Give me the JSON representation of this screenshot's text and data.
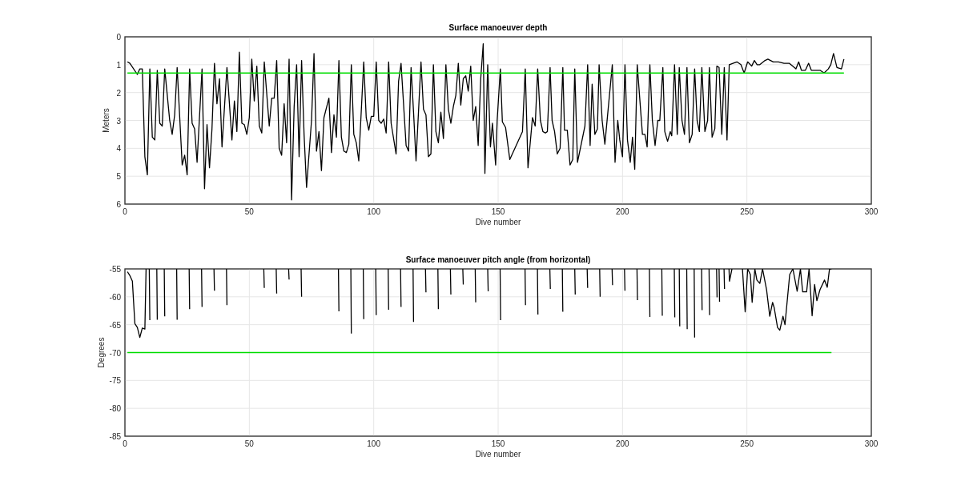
{
  "figure": {
    "plots": [
      {
        "chart_data": {
          "type": "line",
          "title": "Surface manoeuver depth",
          "xlabel": "Dive number",
          "ylabel": "Meters",
          "xlim": [
            0,
            300
          ],
          "ylim": [
            6,
            0
          ],
          "grid": true,
          "xticks": [
            0,
            50,
            100,
            150,
            200,
            250,
            300
          ],
          "yticks": [
            0,
            1,
            2,
            3,
            4,
            5,
            6
          ],
          "x": [
            1,
            2,
            5,
            6,
            7,
            8,
            9,
            10,
            11,
            12,
            13,
            14,
            15,
            16,
            18,
            19,
            20,
            21,
            23,
            24,
            25,
            26,
            27,
            28,
            29,
            31,
            32,
            33,
            34,
            35,
            36,
            37,
            38,
            39,
            41,
            43,
            44,
            45,
            46,
            47,
            48,
            49,
            50,
            51,
            52,
            53,
            54,
            55,
            56,
            58,
            59,
            60,
            61,
            62,
            63,
            64,
            65,
            66,
            67,
            68,
            69,
            70,
            71,
            72,
            73,
            75,
            76,
            77,
            78,
            79,
            80,
            82,
            83,
            84,
            85,
            86,
            87,
            88,
            89,
            90,
            91,
            92,
            93,
            94,
            96,
            97,
            98,
            99,
            100,
            101,
            102,
            103,
            104,
            105,
            106,
            107,
            109,
            110,
            111,
            113,
            114,
            115,
            116,
            117,
            119,
            120,
            121,
            122,
            123,
            124,
            125,
            126,
            127,
            128,
            129,
            130,
            131,
            132,
            133,
            134,
            135,
            136,
            137,
            138,
            139,
            140,
            141,
            142,
            143,
            144,
            144.7,
            145.8,
            146.9,
            147.7,
            149,
            149.6,
            150.9,
            151.7,
            153,
            154.7,
            159.8,
            160.9,
            162,
            163.8,
            164.9,
            165.9,
            167,
            168,
            169,
            169.8,
            170.9,
            171.7,
            172.7,
            173.8,
            174.9,
            176,
            176.7,
            177.8,
            178.9,
            180,
            180.8,
            181.9,
            184.9,
            186,
            187,
            187.8,
            188.9,
            189.9,
            190.6,
            191.8,
            192.9,
            195.9,
            197,
            198.1,
            198.9,
            200,
            201,
            202,
            203.1,
            204,
            204.9,
            205.9,
            208,
            209,
            209.9,
            211,
            212,
            213.1,
            214.2,
            215,
            216.2,
            217,
            218.1,
            219.2,
            219.8,
            220.9,
            222,
            222.8,
            223.9,
            224.9,
            225.9,
            226.9,
            228,
            229,
            230,
            230.9,
            231.9,
            233.1,
            234.2,
            234.9,
            236,
            237.1,
            237.9,
            238.8,
            239.9,
            240.9,
            242,
            242.9,
            244.4,
            246,
            247.6,
            248.9,
            250.3,
            251.9,
            253,
            254.1,
            255.2,
            257.3,
            258.4,
            260.6,
            262.7,
            264.9,
            267,
            269.7,
            270.8,
            271.9,
            273.5,
            274.8,
            275.9,
            277.8,
            279.4,
            281,
            282.7,
            283.7,
            284.8,
            286.2,
            288,
            289
          ],
          "series": [
            {
              "color": "#000000",
              "values": [
                0.9,
                0.95,
                1.35,
                1.15,
                1.15,
                4.3,
                4.95,
                1.15,
                3.6,
                3.7,
                1.2,
                3.1,
                3.2,
                1.15,
                3.0,
                3.5,
                2.8,
                1.1,
                4.6,
                4.25,
                4.95,
                1.15,
                3.1,
                3.3,
                4.5,
                1.15,
                5.45,
                3.15,
                4.7,
                3.3,
                0.95,
                2.4,
                1.5,
                3.95,
                1.1,
                3.7,
                2.3,
                3.4,
                0.55,
                3.1,
                3.15,
                3.5,
                2.9,
                0.8,
                2.3,
                1.05,
                3.2,
                3.45,
                0.9,
                3.2,
                2.2,
                2.2,
                0.85,
                4.0,
                4.25,
                2.4,
                3.8,
                0.8,
                5.85,
                2.5,
                1.0,
                4.3,
                0.85,
                3.5,
                5.4,
                3.0,
                0.6,
                4.1,
                3.4,
                4.8,
                2.9,
                2.2,
                4.15,
                2.8,
                3.6,
                0.85,
                3.6,
                4.1,
                4.15,
                3.85,
                1.0,
                3.5,
                3.8,
                4.45,
                0.9,
                2.9,
                3.35,
                2.85,
                2.85,
                0.9,
                3.0,
                3.1,
                2.95,
                3.45,
                0.9,
                3.1,
                4.2,
                1.6,
                0.95,
                3.9,
                4.1,
                1.1,
                2.7,
                4.45,
                0.9,
                2.6,
                2.8,
                4.3,
                4.2,
                1.0,
                3.4,
                3.8,
                2.7,
                3.65,
                1.0,
                2.6,
                3.1,
                2.5,
                2.1,
                0.95,
                2.45,
                1.5,
                1.4,
                1.95,
                1.05,
                3.0,
                2.5,
                3.9,
                1.5,
                0.25,
                4.9,
                1.0,
                3.95,
                3.1,
                4.6,
                3.0,
                1.15,
                3.05,
                3.25,
                4.4,
                3.4,
                1.15,
                4.7,
                2.9,
                3.2,
                1.15,
                3.0,
                3.4,
                3.45,
                3.4,
                1.1,
                3.0,
                3.4,
                4.2,
                4.0,
                1.1,
                3.35,
                3.35,
                4.6,
                4.4,
                1.15,
                4.5,
                3.2,
                1.0,
                3.9,
                1.7,
                3.5,
                3.3,
                1.0,
                3.0,
                3.85,
                1.0,
                4.5,
                3.0,
                3.7,
                4.3,
                1.0,
                3.7,
                4.5,
                3.6,
                4.75,
                1.0,
                3.5,
                3.5,
                3.95,
                1.0,
                3.0,
                3.9,
                3.0,
                3.0,
                1.1,
                3.4,
                3.75,
                3.4,
                3.55,
                1.0,
                3.5,
                1.1,
                3.0,
                3.5,
                1.1,
                3.8,
                3.5,
                1.15,
                3.0,
                3.4,
                1.1,
                3.4,
                3.0,
                1.1,
                3.6,
                3.3,
                1.05,
                1.1,
                3.5,
                1.1,
                3.7,
                1.0,
                0.95,
                0.9,
                1.0,
                1.3,
                0.9,
                1.05,
                0.85,
                1.0,
                1.0,
                0.85,
                0.8,
                0.9,
                0.9,
                0.95,
                0.95,
                1.15,
                0.9,
                1.2,
                1.2,
                0.95,
                1.2,
                1.2,
                1.2,
                1.3,
                1.15,
                1.0,
                0.6,
                1.1,
                1.15,
                0.8
              ]
            }
          ],
          "ref_lines": [
            {
              "axis": "y",
              "value": 1.3,
              "color": "#00dd00"
            }
          ]
        }
      },
      {
        "chart_data": {
          "type": "line",
          "title": "Surface manoeuver pitch angle (from horizontal)",
          "xlabel": "Dive number",
          "ylabel": "Degrees",
          "xlim": [
            0,
            300
          ],
          "ylim": [
            -85,
            -55
          ],
          "grid": true,
          "xticks": [
            0,
            50,
            100,
            150,
            200,
            250,
            300
          ],
          "yticks": [
            -85,
            -80,
            -75,
            -70,
            -65,
            -60,
            -55
          ],
          "x": [
            1,
            2,
            3,
            4,
            5,
            6,
            7,
            8,
            8.5,
            8.6,
            9.8,
            10,
            10.2,
            12.8,
            13,
            13.2,
            15.8,
            16,
            16.2,
            20.8,
            21,
            21.2,
            25.8,
            26,
            26.2,
            30.8,
            31,
            31.2,
            35.8,
            36,
            36.2,
            40.8,
            41,
            41.2,
            55.8,
            56,
            56.2,
            60.8,
            61,
            61.2,
            65.8,
            66,
            66.2,
            70.8,
            71,
            71.2,
            85.8,
            86,
            86.2,
            90.8,
            91,
            91.2,
            95.8,
            96,
            96.2,
            100.8,
            101,
            101.2,
            105.8,
            106,
            106.2,
            110.8,
            111,
            111.2,
            115.8,
            116,
            116.2,
            120.8,
            121,
            121.2,
            125.8,
            126,
            126.2,
            130.8,
            131,
            131.2,
            135.8,
            136,
            136.2,
            140.8,
            141,
            141.2,
            145.8,
            146,
            146.2,
            150.8,
            151,
            151.2,
            160.8,
            161,
            161.2,
            165.8,
            166,
            166.2,
            170.8,
            171,
            171.2,
            175.8,
            176,
            176.2,
            180.8,
            181,
            181.2,
            185.8,
            186,
            186.2,
            190.8,
            191,
            191.2,
            195.8,
            196,
            196.2,
            200.8,
            201,
            201.2,
            205.8,
            206,
            206.2,
            210.8,
            211,
            211.2,
            215.8,
            216,
            216.2,
            220.8,
            221,
            221.2,
            222.8,
            223,
            223.2,
            225.8,
            226,
            226.2,
            228.8,
            229,
            229.2,
            231.8,
            232,
            232.2,
            234.8,
            235,
            235.2,
            237.8,
            238,
            238.2,
            238.8,
            239,
            239.2,
            240.8,
            241,
            241.2,
            242.8,
            243,
            244,
            244.5,
            248,
            248.2,
            249.3,
            250.3,
            251.4,
            252.1,
            253.2,
            254,
            255.2,
            256.3,
            257.9,
            259.2,
            260.3,
            261,
            262.3,
            263.2,
            264.5,
            265.3,
            267.2,
            268.5,
            270.2,
            271.5,
            272.4,
            274,
            275,
            276.2,
            277.2,
            278.1,
            279.4,
            281.2,
            282.3,
            283.2,
            284
          ],
          "series": [
            {
              "color": "#000000",
              "values": [
                -55.5,
                -56.2,
                -57.2,
                -64.8,
                -65.5,
                -67.3,
                -65.6,
                -65.8,
                -55,
                null,
                -55,
                -64.2,
                null,
                -55,
                -64.1,
                null,
                -55,
                -63.5,
                null,
                -55,
                -64.1,
                null,
                -55,
                -62.2,
                null,
                -55,
                -61.8,
                null,
                -55,
                -58.9,
                null,
                -55,
                -61.5,
                null,
                -55,
                -58.4,
                null,
                -55,
                -59.4,
                null,
                -55,
                -56.9,
                null,
                -55,
                -60,
                null,
                -55,
                -62.6,
                null,
                -55,
                -66.6,
                null,
                -55,
                -64,
                null,
                -55,
                -63.3,
                null,
                -55,
                -62.3,
                null,
                -55,
                -61.8,
                null,
                -55,
                -64.5,
                null,
                -55,
                -59.2,
                null,
                -55,
                -62.2,
                null,
                -55,
                -59.6,
                null,
                -55,
                -57.8,
                null,
                -55,
                -61.0,
                null,
                -55,
                -59,
                null,
                -55,
                -64.2,
                null,
                -55,
                -61.5,
                null,
                -55,
                -63.2,
                null,
                -55,
                -58.6,
                null,
                -55,
                -62.7,
                null,
                -55,
                -59.6,
                null,
                -55,
                -58.4,
                null,
                -55,
                -60,
                null,
                -55,
                -57.9,
                null,
                -55,
                -58.9,
                null,
                -55,
                -60.6,
                null,
                -55,
                -63.6,
                null,
                -55,
                -63.4,
                null,
                -55,
                -63.7,
                null,
                -55,
                -65.3,
                null,
                -55,
                -65.8,
                null,
                -55,
                -67.3,
                null,
                -55,
                -62.4,
                null,
                -55,
                -63.3,
                null,
                -55,
                -60.1,
                null,
                -55,
                -60.9,
                null,
                -55,
                -58.6,
                null,
                -55,
                -57.2,
                -55,
                null,
                null,
                -55,
                -62.7,
                -55,
                -56,
                -61,
                -55,
                -57,
                -57.6,
                -55,
                -58.7,
                -63.5,
                -61,
                -62,
                -65.5,
                -66,
                -63.5,
                -65,
                -56,
                -55,
                -59,
                -55,
                -59.1,
                -59.1,
                -55,
                -63.4,
                -57.8,
                -60.7,
                -58.7,
                -57,
                -58.3,
                -55,
                -55
              ]
            }
          ],
          "ref_lines": [
            {
              "axis": "y",
              "value": -70,
              "color": "#00dd00"
            }
          ]
        }
      }
    ]
  }
}
